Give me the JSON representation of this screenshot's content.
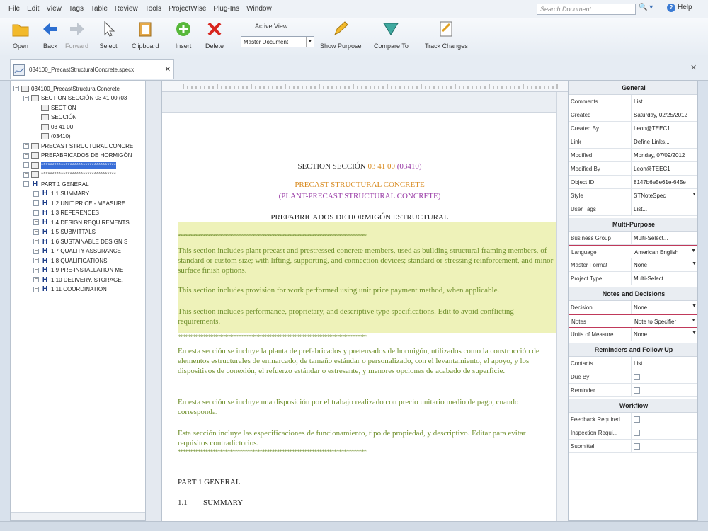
{
  "menu": [
    "File",
    "Edit",
    "View",
    "Tags",
    "Table",
    "Review",
    "Tools",
    "ProjectWise",
    "Plug-Ins",
    "Window"
  ],
  "search": {
    "placeholder": "Search Document",
    "help": "Help"
  },
  "toolbar": {
    "open": "Open",
    "back": "Back",
    "forward": "Forward",
    "select": "Select",
    "clipboard": "Clipboard",
    "insert": "Insert",
    "delete": "Delete",
    "active_view_label": "Active View",
    "active_view_value": "Master Document",
    "show_purpose": "Show Purpose",
    "compare_to": "Compare To",
    "track_changes": "Track Changes"
  },
  "tab": {
    "label": "034100_PrecastStructuralConcrete.specx"
  },
  "tree": [
    {
      "label": "034100_PrecastStructuralConcrete",
      "level": 0
    },
    {
      "label": "SECTION SECCIÓN 03 41 00 (03",
      "level": 1
    },
    {
      "label": "SECTION",
      "level": 2
    },
    {
      "label": "SECCIÓN",
      "level": 2
    },
    {
      "label": "03 41 00",
      "level": 2
    },
    {
      "label": "(03410)",
      "level": 2
    },
    {
      "label": "PRECAST STRUCTURAL CONCRE",
      "level": 1
    },
    {
      "label": "PREFABRICADOS DE HORMIGÓN",
      "level": 1
    },
    {
      "label": "**********************************",
      "level": 1,
      "selected": true
    },
    {
      "label": "**********************************",
      "level": 1
    },
    {
      "label": "PART 1 GENERAL",
      "level": 1
    },
    {
      "label": "1.1 SUMMARY",
      "level": 2
    },
    {
      "label": "1.2 UNIT PRICE - MEASURE",
      "level": 2
    },
    {
      "label": "1.3 REFERENCES",
      "level": 2
    },
    {
      "label": "1.4 DESIGN REQUIREMENTS",
      "level": 2
    },
    {
      "label": "1.5 SUBMITTALS",
      "level": 2
    },
    {
      "label": "1.6 SUSTAINABLE DESIGN S",
      "level": 2
    },
    {
      "label": "1.7 QUALITY ASSURANCE",
      "level": 2
    },
    {
      "label": "1.8 QUALIFICATIONS",
      "level": 2
    },
    {
      "label": "1.9 PRE-INSTALLATION ME",
      "level": 2
    },
    {
      "label": "1.10 DELIVERY, STORAGE,",
      "level": 2
    },
    {
      "label": "1.11 COORDINATION",
      "level": 2
    }
  ],
  "doc": {
    "section_prefix": "SECTION SECCIÓN",
    "section_number": "03 41 00",
    "section_old": "(03410)",
    "title1": "PRECAST STRUCTURAL CONCRETE",
    "title2": "(PLANT-PRECAST STRUCTURAL CONCRETE)",
    "title_es": "PREFABRICADOS DE HORMIGÓN ESTRUCTURAL",
    "stars": "****************************************************************************",
    "note1": "This section includes plant precast and prestressed concrete members, used as building structural framing members, of standard or custom size; with lifting, supporting, and connection devices; standard or stressing reinforcement, and minor surface finish options.",
    "note2": "This section includes provision for work performed using unit price payment method, when applicable.",
    "note3": "This section includes performance, proprietary, and descriptive type specifications. Edit to avoid conflicting requirements.",
    "es1": "En esta sección se incluye la planta de prefabricados y pretensados de hormigón, utilizados como la construcción de elementos estructurales de enmarcado, de tamaño estándar o personalizado, con el levantamiento, el apoyo, y los dispositivos de conexión, el refuerzo estándar o estresante, y menores opciones de acabado de superficie.",
    "es2": "En esta sección se incluye una disposición por el trabajo realizado con precio unitario medio de pago, cuando corresponda.",
    "es3": "Esta sección incluye las especificaciones de funcionamiento, tipo de propiedad, y descriptivo. Editar para evitar requisitos contradictorios.",
    "part1": "PART 1 GENERAL",
    "summary_num": "1.1",
    "summary": "SUMMARY"
  },
  "props": {
    "general": "General",
    "comments": {
      "label": "Comments",
      "value": "List..."
    },
    "created": {
      "label": "Created",
      "value": "Saturday, 02/25/2012"
    },
    "created_by": {
      "label": "Created By",
      "value": "Leon@TEEC1"
    },
    "link": {
      "label": "Link",
      "value": "Define Links..."
    },
    "modified": {
      "label": "Modified",
      "value": "Monday, 07/09/2012"
    },
    "modified_by": {
      "label": "Modified By",
      "value": "Leon@TEEC1"
    },
    "object_id": {
      "label": "Object ID",
      "value": "8147b6e5e61e-645e"
    },
    "style": {
      "label": "Style",
      "value": "STNoteSpec"
    },
    "user_tags": {
      "label": "User Tags",
      "value": "List..."
    },
    "multi": "Multi-Purpose",
    "business_group": {
      "label": "Business Group",
      "value": "Multi-Select..."
    },
    "language": {
      "label": "Language",
      "value": "American English"
    },
    "master_format": {
      "label": "Master Format",
      "value": "None"
    },
    "project_type": {
      "label": "Project Type",
      "value": "Multi-Select..."
    },
    "notes_dec": "Notes and Decisions",
    "decision": {
      "label": "Decision",
      "value": "None"
    },
    "notes": {
      "label": "Notes",
      "value": "Note to Specifier"
    },
    "units": {
      "label": "Units of Measure",
      "value": "None"
    },
    "reminders": "Reminders and Follow Up",
    "contacts": {
      "label": "Contacts",
      "value": "List..."
    },
    "due_by": {
      "label": "Due By"
    },
    "reminder": {
      "label": "Reminder"
    },
    "workflow": "Workflow",
    "feedback": {
      "label": "Feedback Required"
    },
    "inspection": {
      "label": "Inspection Requi..."
    },
    "submittal": {
      "label": "Submittal"
    }
  },
  "colors": {
    "accent": "#3a6fd8",
    "note_bg": "#eef2b9",
    "note_text": "#6f8f2c",
    "title_orange": "#d88a1e",
    "title_purple": "#9b3fa8"
  }
}
